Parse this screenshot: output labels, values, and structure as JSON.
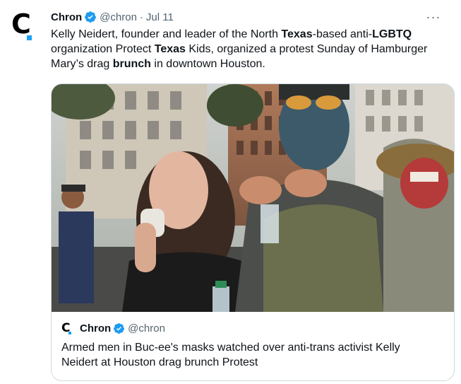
{
  "tweet": {
    "author_name": "Chron",
    "author_handle": "@chron",
    "separator": "·",
    "date": "Jul 11",
    "more_label": "···",
    "text_parts": [
      {
        "t": "Kelly Neidert, founder and leader of the North "
      },
      {
        "t": "Texas",
        "b": true
      },
      {
        "t": "-based anti-"
      },
      {
        "t": "LGBTQ",
        "b": true
      },
      {
        "t": " organization Protect "
      },
      {
        "t": "Texas",
        "b": true
      },
      {
        "t": " Kids, organized a protest Sunday of Hamburger Mary’s drag "
      },
      {
        "t": "brunch",
        "b": true
      },
      {
        "t": " in downtown Houston."
      }
    ]
  },
  "avatar": {
    "letter": "C"
  },
  "quoted": {
    "author_name": "Chron",
    "author_handle": "@chron",
    "logo_letter": "C",
    "text": "Armed men in Buc-ee's masks watched over anti-trans activist Kelly Neidert at Houston drag brunch Protest"
  },
  "colors": {
    "accent": "#1da1f2",
    "verified": "#1d9bf0",
    "secondary_text": "#536471",
    "border": "#cfd9de"
  },
  "icons": {
    "verified": "verified-badge-icon",
    "more": "more-options-icon"
  }
}
